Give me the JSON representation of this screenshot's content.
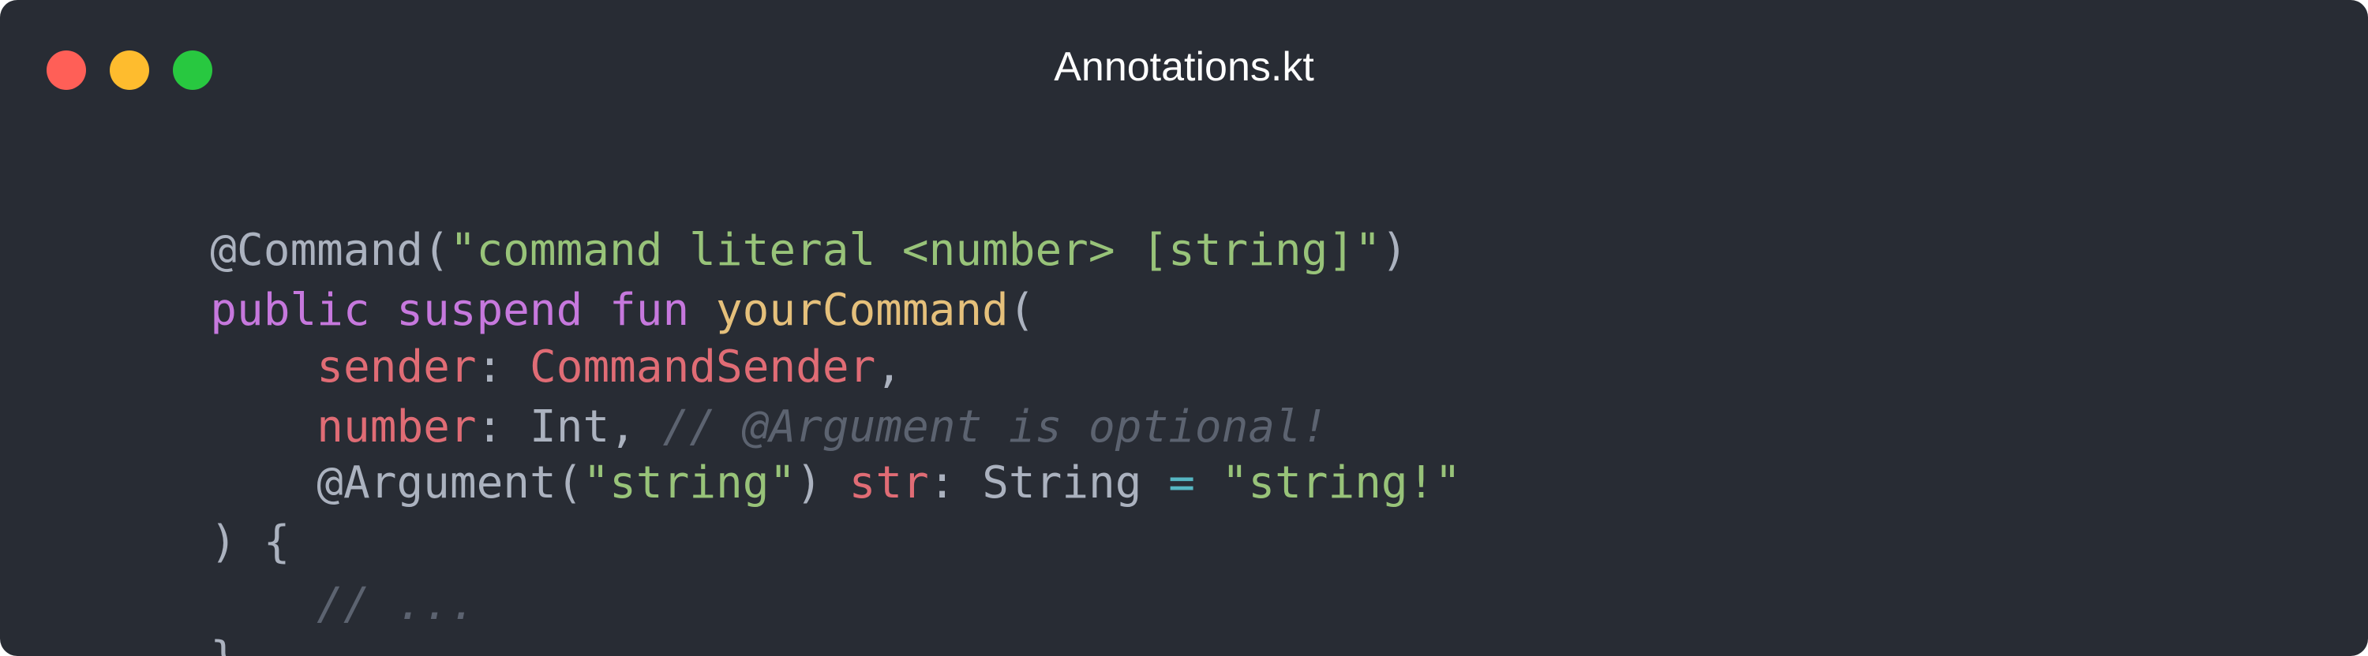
{
  "window": {
    "title": "Annotations.kt",
    "traffic_lights": {
      "close_color": "#ff5f57",
      "minimize_color": "#febc2e",
      "zoom_color": "#28c840"
    }
  },
  "colors": {
    "background": "#282c34",
    "default_text": "#abb2bf",
    "string": "#98c379",
    "keyword": "#c678dd",
    "function_name": "#e5c07b",
    "parameter": "#e06c75",
    "operator": "#56b6c2",
    "comment": "#5c6370"
  },
  "code": {
    "lines": [
      [
        {
          "text": "@Command(",
          "kind": "default_text"
        },
        {
          "text": "\"command literal <number> [string]\"",
          "kind": "string"
        },
        {
          "text": ")",
          "kind": "default_text"
        }
      ],
      [
        {
          "text": "public suspend fun ",
          "kind": "keyword"
        },
        {
          "text": "yourCommand",
          "kind": "function_name"
        },
        {
          "text": "(",
          "kind": "default_text"
        }
      ],
      [
        {
          "text": "sender",
          "kind": "parameter"
        },
        {
          "text": ": ",
          "kind": "default_text"
        },
        {
          "text": "CommandSender",
          "kind": "parameter"
        },
        {
          "text": ",",
          "kind": "default_text"
        }
      ],
      [
        {
          "text": "number",
          "kind": "parameter"
        },
        {
          "text": ": Int, ",
          "kind": "default_text"
        },
        {
          "text": "// @Argument is optional!",
          "kind": "comment"
        }
      ],
      [
        {
          "text": "@Argument(",
          "kind": "default_text"
        },
        {
          "text": "\"string\"",
          "kind": "string"
        },
        {
          "text": ") ",
          "kind": "default_text"
        },
        {
          "text": "str",
          "kind": "parameter"
        },
        {
          "text": ": String ",
          "kind": "default_text"
        },
        {
          "text": "=",
          "kind": "operator"
        },
        {
          "text": " ",
          "kind": "default_text"
        },
        {
          "text": "\"string!\"",
          "kind": "string"
        }
      ],
      [
        {
          "text": ") {",
          "kind": "default_text"
        }
      ],
      [
        {
          "text": "// ...",
          "kind": "comment"
        }
      ],
      [
        {
          "text": "}",
          "kind": "default_text"
        }
      ]
    ]
  }
}
